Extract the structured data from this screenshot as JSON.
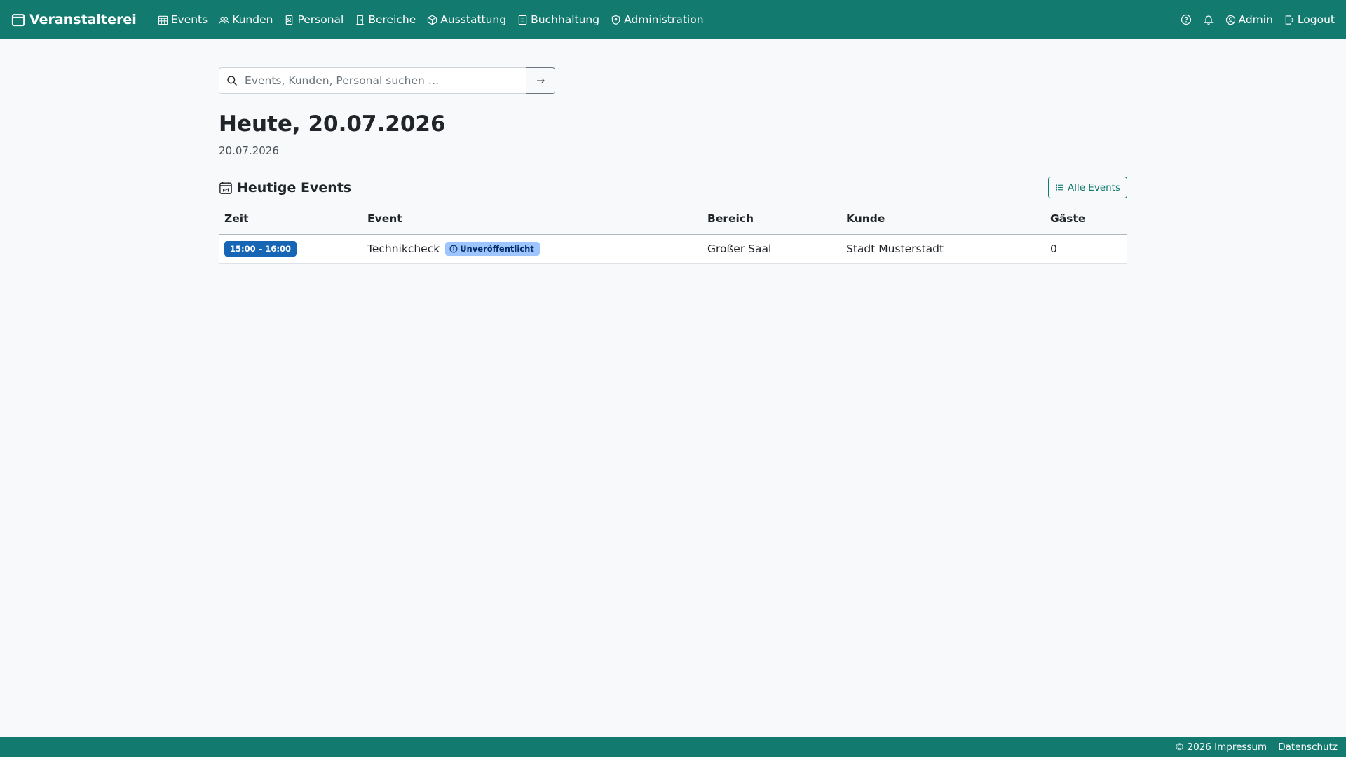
{
  "colors": {
    "brand": "#127a6f",
    "time_badge": "#1766b5",
    "status_badge": "#9ec5fe"
  },
  "navbar": {
    "brand": "Veranstalterei",
    "brand_icon": "calendar-icon",
    "items": [
      {
        "label": "Events",
        "icon": "calendar-grid-icon"
      },
      {
        "label": "Kunden",
        "icon": "people-icon"
      },
      {
        "label": "Personal",
        "icon": "id-badge-icon"
      },
      {
        "label": "Bereiche",
        "icon": "door-icon"
      },
      {
        "label": "Ausstattung",
        "icon": "box-icon"
      },
      {
        "label": "Buchhaltung",
        "icon": "ledger-icon"
      },
      {
        "label": "Administration",
        "icon": "shield-icon"
      }
    ],
    "right": {
      "help_icon": "question-circle-icon",
      "notifications_icon": "bell-icon",
      "user_label": "Admin",
      "logout_label": "Logout"
    }
  },
  "search": {
    "placeholder": "Events, Kunden, Personal suchen …",
    "value": ""
  },
  "page": {
    "title": "Heute, 20.07.2026",
    "subtitle": "20.07.2026"
  },
  "section": {
    "title": "Heutige Events",
    "all_events_label": "Alle Events"
  },
  "table": {
    "headers": [
      "Zeit",
      "Event",
      "Bereich",
      "Kunde",
      "Gäste"
    ],
    "rows": [
      {
        "time": "15:00 – 16:00",
        "event": "Technikcheck",
        "status": "Unveröffentlicht",
        "area": "Großer Saal",
        "customer": "Stadt Musterstadt",
        "guests": "0"
      }
    ]
  },
  "footer": {
    "copyright": "© 2026 Impressum",
    "privacy": "Datenschutz"
  }
}
